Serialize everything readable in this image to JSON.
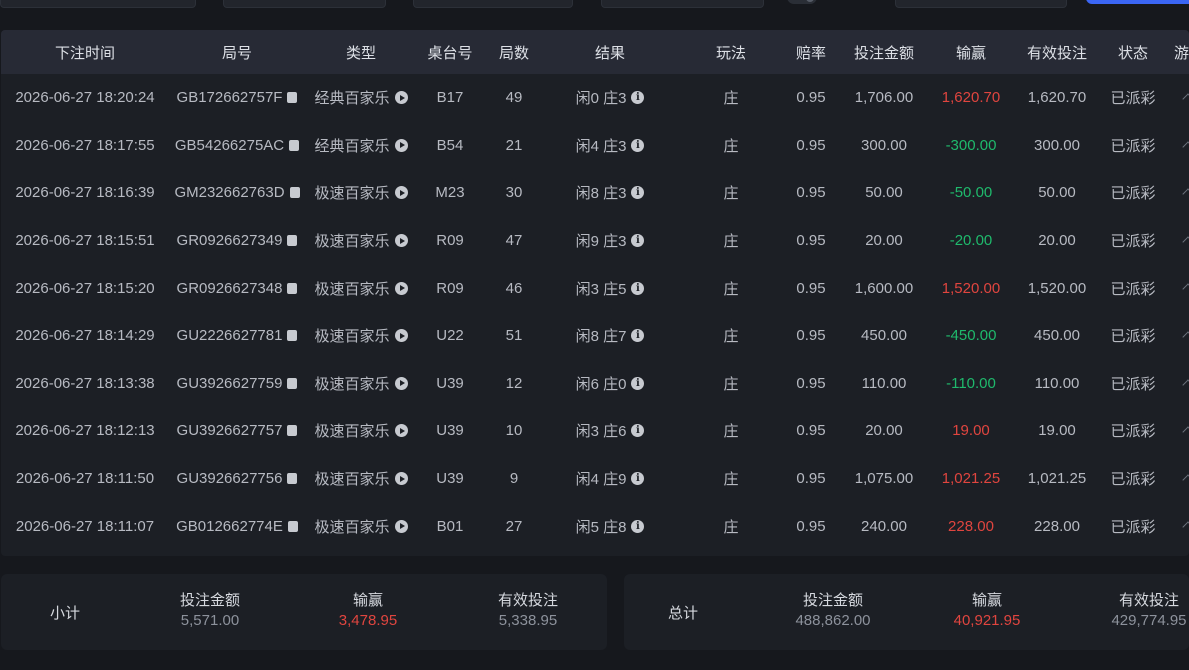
{
  "table": {
    "headers": [
      "下注时间",
      "局号",
      "类型",
      "桌台号",
      "局数",
      "结果",
      "玩法",
      "赔率",
      "投注金额",
      "输赢",
      "有效投注",
      "状态",
      "游戏"
    ],
    "rows": [
      {
        "time": "2026-06-27 18:20:24",
        "round_id": "GB172662757F",
        "type": "经典百家乐",
        "table": "B17",
        "round": "49",
        "result": "闲0 庄3",
        "bet_type": "庄",
        "odds": "0.95",
        "amount": "1,706.00",
        "win_loss": "1,620.70",
        "win_sign": "pos",
        "valid": "1,620.70",
        "status": "已派彩"
      },
      {
        "time": "2026-06-27 18:17:55",
        "round_id": "GB54266275AC",
        "type": "经典百家乐",
        "table": "B54",
        "round": "21",
        "result": "闲4 庄3",
        "bet_type": "庄",
        "odds": "0.95",
        "amount": "300.00",
        "win_loss": "-300.00",
        "win_sign": "neg",
        "valid": "300.00",
        "status": "已派彩"
      },
      {
        "time": "2026-06-27 18:16:39",
        "round_id": "GM232662763D",
        "type": "极速百家乐",
        "table": "M23",
        "round": "30",
        "result": "闲8 庄3",
        "bet_type": "庄",
        "odds": "0.95",
        "amount": "50.00",
        "win_loss": "-50.00",
        "win_sign": "neg",
        "valid": "50.00",
        "status": "已派彩"
      },
      {
        "time": "2026-06-27 18:15:51",
        "round_id": "GR0926627349",
        "type": "极速百家乐",
        "table": "R09",
        "round": "47",
        "result": "闲9 庄3",
        "bet_type": "庄",
        "odds": "0.95",
        "amount": "20.00",
        "win_loss": "-20.00",
        "win_sign": "neg",
        "valid": "20.00",
        "status": "已派彩"
      },
      {
        "time": "2026-06-27 18:15:20",
        "round_id": "GR0926627348",
        "type": "极速百家乐",
        "table": "R09",
        "round": "46",
        "result": "闲3 庄5",
        "bet_type": "庄",
        "odds": "0.95",
        "amount": "1,600.00",
        "win_loss": "1,520.00",
        "win_sign": "pos",
        "valid": "1,520.00",
        "status": "已派彩"
      },
      {
        "time": "2026-06-27 18:14:29",
        "round_id": "GU2226627781",
        "type": "极速百家乐",
        "table": "U22",
        "round": "51",
        "result": "闲8 庄7",
        "bet_type": "庄",
        "odds": "0.95",
        "amount": "450.00",
        "win_loss": "-450.00",
        "win_sign": "neg",
        "valid": "450.00",
        "status": "已派彩"
      },
      {
        "time": "2026-06-27 18:13:38",
        "round_id": "GU3926627759",
        "type": "极速百家乐",
        "table": "U39",
        "round": "12",
        "result": "闲6 庄0",
        "bet_type": "庄",
        "odds": "0.95",
        "amount": "110.00",
        "win_loss": "-110.00",
        "win_sign": "neg",
        "valid": "110.00",
        "status": "已派彩"
      },
      {
        "time": "2026-06-27 18:12:13",
        "round_id": "GU3926627757",
        "type": "极速百家乐",
        "table": "U39",
        "round": "10",
        "result": "闲3 庄6",
        "bet_type": "庄",
        "odds": "0.95",
        "amount": "20.00",
        "win_loss": "19.00",
        "win_sign": "pos",
        "valid": "19.00",
        "status": "已派彩"
      },
      {
        "time": "2026-06-27 18:11:50",
        "round_id": "GU3926627756",
        "type": "极速百家乐",
        "table": "U39",
        "round": "9",
        "result": "闲4 庄9",
        "bet_type": "庄",
        "odds": "0.95",
        "amount": "1,075.00",
        "win_loss": "1,021.25",
        "win_sign": "pos",
        "valid": "1,021.25",
        "status": "已派彩"
      },
      {
        "time": "2026-06-27 18:11:07",
        "round_id": "GB012662774E",
        "type": "极速百家乐",
        "table": "B01",
        "round": "27",
        "result": "闲5 庄8",
        "bet_type": "庄",
        "odds": "0.95",
        "amount": "240.00",
        "win_loss": "228.00",
        "win_sign": "pos",
        "valid": "228.00",
        "status": "已派彩"
      }
    ]
  },
  "subtotal": {
    "title": "小计",
    "bet_label": "投注金额",
    "bet_value": "5,571.00",
    "win_label": "输赢",
    "win_value": "3,478.95",
    "valid_label": "有效投注",
    "valid_value": "5,338.95"
  },
  "total": {
    "title": "总计",
    "bet_label": "投注金额",
    "bet_value": "488,862.00",
    "win_label": "输赢",
    "win_value": "40,921.95",
    "valid_label": "有效投注",
    "valid_value": "429,774.95"
  },
  "colors": {
    "positive": "#e0453f",
    "negative": "#1fb96c",
    "accent": "#3b66f5"
  }
}
